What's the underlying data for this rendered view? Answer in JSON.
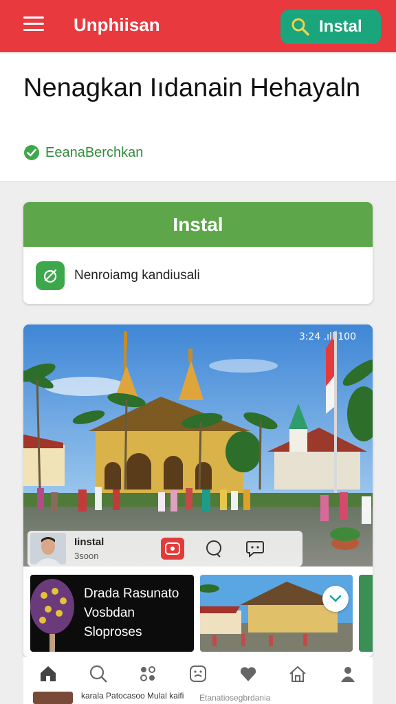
{
  "header": {
    "app_title": "Unphiisan",
    "install_label": "Instal",
    "brand_color": "#e8393f",
    "install_color": "#1aa57c"
  },
  "hero": {
    "title": "Nenagkan Iıdanain Hehayaln",
    "verified_label": "EeanaBerchkan"
  },
  "install_card": {
    "button_label": "Instal",
    "button_color": "#5da74a",
    "feature_label": "Nenroiamg kandiusali"
  },
  "media": {
    "status_bar": "3:24 .ıll 100",
    "user": {
      "name": "Iinstal",
      "sub": "3soon"
    },
    "thumbs": [
      {
        "lines": [
          "Drada Rasunato",
          "Vosbdan",
          "Sloproses"
        ]
      }
    ]
  },
  "bottom_nav": [
    "home-icon",
    "search-icon",
    "apps-icon",
    "face-icon",
    "heart-icon",
    "house-icon",
    "profile-icon"
  ],
  "footer": {
    "text_1": "karala Patocasoo Mulal kaifi",
    "text_2": "Etanatiosegbrdania"
  }
}
